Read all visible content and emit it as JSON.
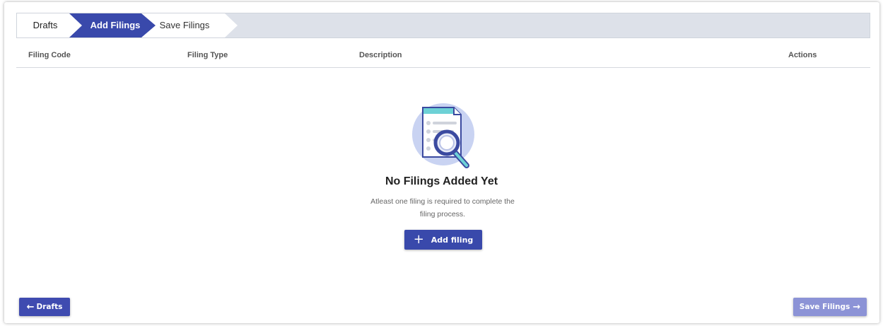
{
  "stepper": {
    "steps": [
      {
        "label": "Drafts",
        "state": "completed"
      },
      {
        "label": "Add Filings",
        "state": "active"
      },
      {
        "label": "Save Filings",
        "state": "upcoming"
      }
    ]
  },
  "table": {
    "columns": [
      "Filing Code",
      "Filing Type",
      "Description",
      "Actions"
    ]
  },
  "empty_state": {
    "icon": "document-search-icon",
    "title": "No Filings Added Yet",
    "description_line1": "Atleast one filing is required to complete the",
    "description_line2": "filing process.",
    "add_button_label": "Add filing"
  },
  "footer": {
    "back_label": "Drafts",
    "next_label": "Save Filings"
  },
  "colors": {
    "primary": "#3949ab",
    "primary_disabled": "#8c93d6",
    "stepper_bg": "#dde1e9",
    "illustration_circle": "#c9d3f2",
    "illustration_accent": "#6dd1d6"
  }
}
